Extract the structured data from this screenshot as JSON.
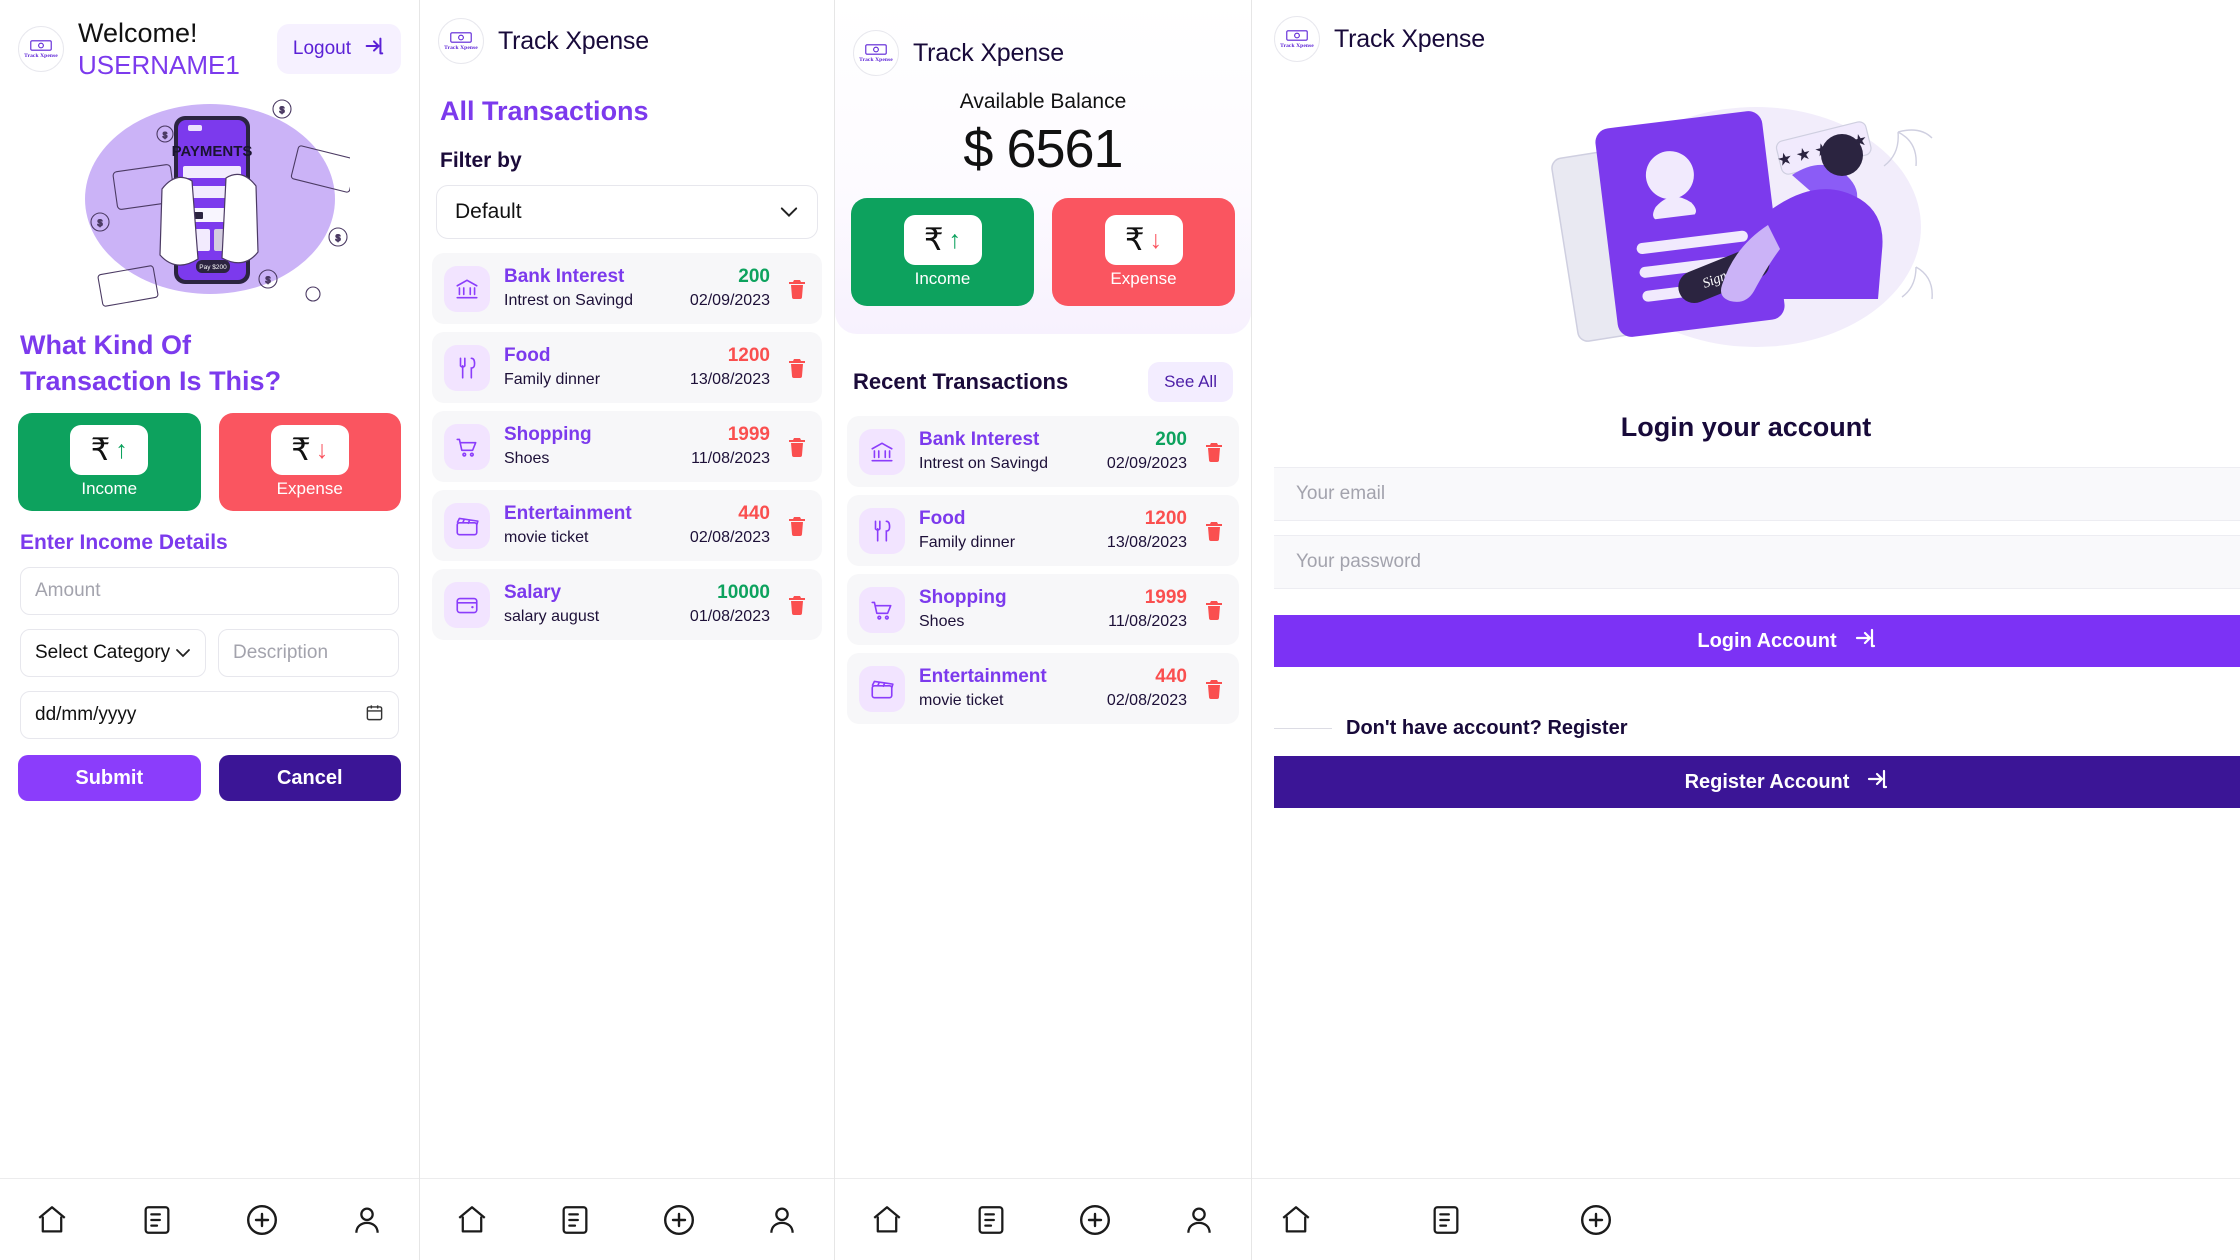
{
  "brand": {
    "name": "Track Xpense",
    "logo_text": "Track Xpense"
  },
  "colors": {
    "purple": "#7c3aed",
    "deep_purple": "#3b1596",
    "violet": "#8b3dfb",
    "green": "#0da25e",
    "red": "#fa5560",
    "amount_red": "#fa4f4f",
    "lilac_bg": "#f2e4ff",
    "row_bg": "#f7f7f9"
  },
  "panel1": {
    "welcome": "Welcome!",
    "username": "USERNAME1",
    "logout_label": "Logout",
    "logout_icon": "logout-arrow-icon",
    "question_line1": "What Kind Of",
    "question_line2": "Transaction Is This?",
    "income_label": "Income",
    "expense_label": "Expense",
    "currency_symbol": "₹",
    "income_arrow": "↑",
    "expense_arrow": "↓",
    "details_label": "Enter Income Details",
    "amount_placeholder": "Amount",
    "category_value": "Select Category",
    "description_placeholder": "Description",
    "date_placeholder": "dd/mm/yyyy",
    "submit_label": "Submit",
    "cancel_label": "Cancel"
  },
  "panel2": {
    "title": "All Transactions",
    "filter_label": "Filter by",
    "filter_value": "Default",
    "transactions": [
      {
        "icon": "bank-icon",
        "category": "Bank Interest",
        "note": "Intrest on Savingd",
        "amount": "200",
        "date": "02/09/2023",
        "type": "income"
      },
      {
        "icon": "food-icon",
        "category": "Food",
        "note": "Family dinner",
        "amount": "1200",
        "date": "13/08/2023",
        "type": "expense"
      },
      {
        "icon": "shopping-cart-icon",
        "category": "Shopping",
        "note": "Shoes",
        "amount": "1999",
        "date": "11/08/2023",
        "type": "expense"
      },
      {
        "icon": "clapperboard-icon",
        "category": "Entertainment",
        "note": "movie ticket",
        "amount": "440",
        "date": "02/08/2023",
        "type": "expense"
      },
      {
        "icon": "wallet-icon",
        "category": "Salary",
        "note": "salary august",
        "amount": "10000",
        "date": "01/08/2023",
        "type": "income"
      }
    ]
  },
  "panel3": {
    "balance_label": "Available Balance",
    "balance_amount": "$ 6561",
    "income_label": "Income",
    "expense_label": "Expense",
    "currency_symbol": "₹",
    "recent_title": "Recent Transactions",
    "see_all_label": "See All",
    "transactions": [
      {
        "icon": "bank-icon",
        "category": "Bank Interest",
        "note": "Intrest on Savingd",
        "amount": "200",
        "date": "02/09/2023",
        "type": "income"
      },
      {
        "icon": "food-icon",
        "category": "Food",
        "note": "Family dinner",
        "amount": "1200",
        "date": "13/08/2023",
        "type": "expense"
      },
      {
        "icon": "shopping-cart-icon",
        "category": "Shopping",
        "note": "Shoes",
        "amount": "1999",
        "date": "11/08/2023",
        "type": "expense"
      },
      {
        "icon": "clapperboard-icon",
        "category": "Entertainment",
        "note": "movie ticket",
        "amount": "440",
        "date": "02/08/2023",
        "type": "expense"
      }
    ]
  },
  "panel4": {
    "login_title": "Login your account",
    "email_placeholder": "Your email",
    "password_placeholder": "Your password",
    "login_button": "Login Account",
    "register_prompt": "Don't have account? Register",
    "register_button": "Register Account",
    "signup_badge": "Sign Up"
  },
  "bottom_nav": {
    "items": [
      {
        "icon": "home-icon",
        "label": "Home"
      },
      {
        "icon": "list-icon",
        "label": "Transactions"
      },
      {
        "icon": "plus-circle-icon",
        "label": "Add"
      },
      {
        "icon": "person-icon",
        "label": "Profile"
      }
    ]
  }
}
